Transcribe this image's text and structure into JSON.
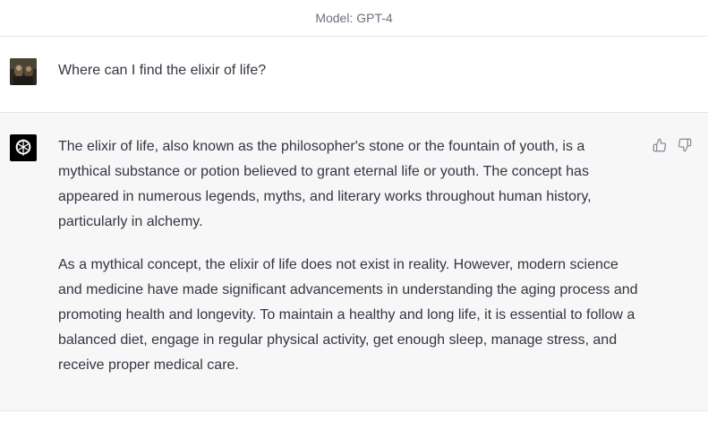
{
  "header": {
    "model_label": "Model: GPT-4"
  },
  "conversation": {
    "user_message": "Where can I find the elixir of life?",
    "assistant_paragraphs": [
      "The elixir of life, also known as the philosopher's stone or the fountain of youth, is a mythical substance or potion believed to grant eternal life or youth. The concept has appeared in numerous legends, myths, and literary works throughout human history, particularly in alchemy.",
      "As a mythical concept, the elixir of life does not exist in reality. However, modern science and medicine have made significant advancements in understanding the aging process and promoting health and longevity. To maintain a healthy and long life, it is essential to follow a balanced diet, engage in regular physical activity, get enough sleep, manage stress, and receive proper medical care."
    ]
  },
  "icons": {
    "assistant_avatar": "openai-logo-icon",
    "thumbs_up": "thumbs-up-icon",
    "thumbs_down": "thumbs-down-icon"
  },
  "colors": {
    "assistant_bg": "#f7f7f8",
    "avatar_bot_bg": "#000000",
    "text": "#343541",
    "muted": "#6e6e80"
  }
}
